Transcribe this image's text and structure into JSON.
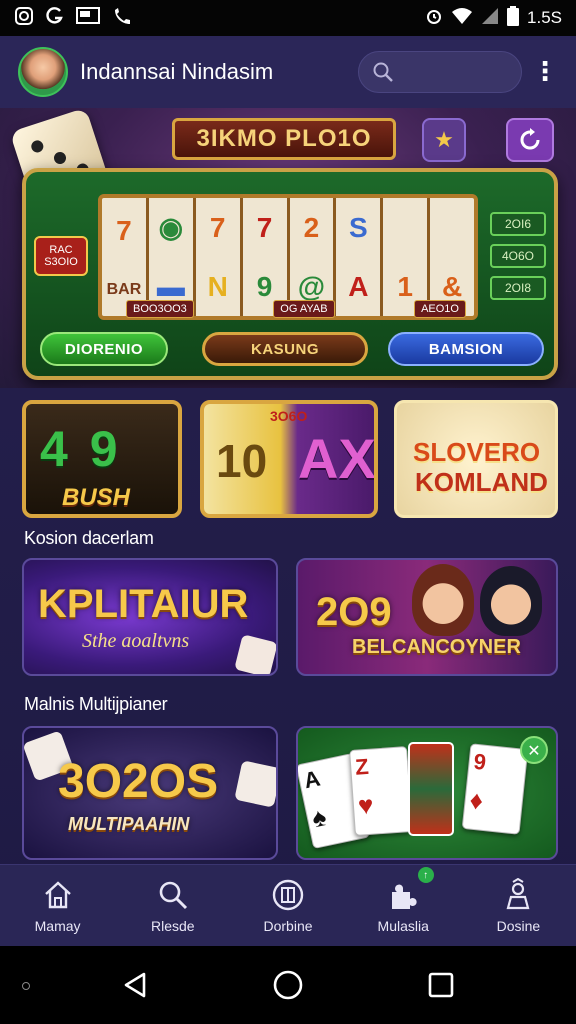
{
  "status_bar": {
    "time": "1.5S",
    "left_icons": [
      "instagram-icon",
      "g-icon",
      "screen-icon",
      "call-forward-icon"
    ],
    "right_icons": [
      "alarm-icon",
      "wifi-icon",
      "signal-icon",
      "battery-icon"
    ]
  },
  "header": {
    "title": "Indannsai Nindasim",
    "search_placeholder": ""
  },
  "hero": {
    "banner": "3IKMO PLO1O",
    "side_left_label": "RAC\nS3OIO",
    "side_right_values": [
      "2OI6",
      "4O6O",
      "2OI8"
    ],
    "reel_labels": [
      "BOO3OO3",
      "OG AYAB",
      "AEO1O"
    ],
    "buttons": {
      "green": "DIORENIO",
      "brown": "KASUNG",
      "blue": "BAMSION"
    }
  },
  "tiles": [
    {
      "line1": "4 9",
      "line2": "BUSH"
    },
    {
      "line1": "10",
      "line2": "AX",
      "badge": "3O6O"
    },
    {
      "line1": "SLOVERO",
      "line2": "KOMLAND"
    }
  ],
  "section1": {
    "label": "Kosion dacerlam",
    "card1_title": "KPLITAIUR",
    "card1_sub": "Sthe aoaltvns",
    "card2_title": "2O9",
    "card2_sub": "BELCANCOYNER"
  },
  "section2": {
    "label": "Malnis Multijpianer",
    "card3_title": "3O2OS",
    "card3_sub": "MULTIPAAHIN",
    "card4_cards": [
      "A",
      "Z",
      "9"
    ]
  },
  "bottom_nav": [
    {
      "label": "Mamay",
      "icon": "home-icon"
    },
    {
      "label": "Rlesde",
      "icon": "search-icon"
    },
    {
      "label": "Dorbine",
      "icon": "game-icon"
    },
    {
      "label": "Mulaslia",
      "icon": "multiplayer-icon"
    },
    {
      "label": "Dosine",
      "icon": "profile-icon"
    }
  ],
  "colors": {
    "app_bg": "#231e4a",
    "accent_gold": "#d9a640",
    "nav_bg": "#2a2656"
  }
}
